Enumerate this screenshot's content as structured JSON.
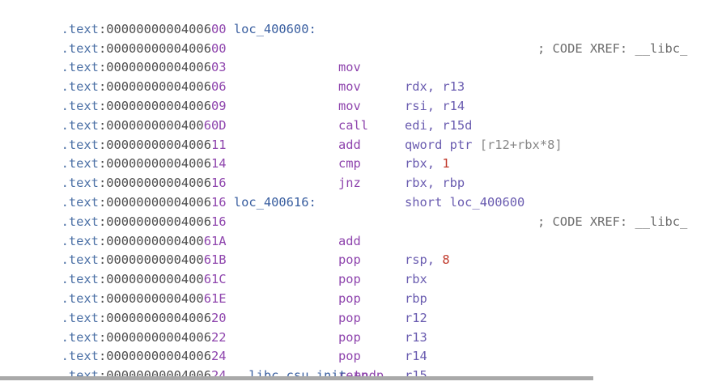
{
  "disassembly": {
    "rows": [
      {
        "seg": ".text",
        "addr_prefix": "00000000004006",
        "addr_hex": "00",
        "label": "loc_400600:",
        "mnemonic": "",
        "op1": "",
        "op2": "",
        "comment": "; CODE XREF: __libc_"
      },
      {
        "seg": ".text",
        "addr_prefix": "00000000004006",
        "addr_hex": "00",
        "label": "",
        "mnemonic": "mov",
        "op1": "rdx,",
        "op2": "r13",
        "comment": ""
      },
      {
        "seg": ".text",
        "addr_prefix": "00000000004006",
        "addr_hex": "03",
        "label": "",
        "mnemonic": "mov",
        "op1": "rsi,",
        "op2": "r14",
        "comment": ""
      },
      {
        "seg": ".text",
        "addr_prefix": "00000000004006",
        "addr_hex": "06",
        "label": "",
        "mnemonic": "mov",
        "op1": "edi,",
        "op2": "r15d",
        "comment": ""
      },
      {
        "seg": ".text",
        "addr_prefix": "00000000004006",
        "addr_hex": "09",
        "label": "",
        "mnemonic": "call",
        "op1": "qword ptr",
        "op2": "[r12+rbx*8]",
        "comment": ""
      },
      {
        "seg": ".text",
        "addr_prefix": "0000000000400",
        "addr_hex": "60D",
        "label": "",
        "mnemonic": "add",
        "op1": "rbx,",
        "op2": "1",
        "comment": ""
      },
      {
        "seg": ".text",
        "addr_prefix": "00000000004006",
        "addr_hex": "11",
        "label": "",
        "mnemonic": "cmp",
        "op1": "rbx,",
        "op2": "rbp",
        "comment": ""
      },
      {
        "seg": ".text",
        "addr_prefix": "00000000004006",
        "addr_hex": "14",
        "label": "",
        "mnemonic": "jnz",
        "op1": "short",
        "op2": "loc_400600",
        "comment": ""
      },
      {
        "seg": ".text",
        "addr_prefix": "00000000004006",
        "addr_hex": "16",
        "label": "",
        "mnemonic": "",
        "op1": "",
        "op2": "",
        "comment": ""
      },
      {
        "seg": ".text",
        "addr_prefix": "00000000004006",
        "addr_hex": "16",
        "label": "loc_400616:",
        "mnemonic": "",
        "op1": "",
        "op2": "",
        "comment": "; CODE XREF: __libc_"
      },
      {
        "seg": ".text",
        "addr_prefix": "00000000004006",
        "addr_hex": "16",
        "label": "",
        "mnemonic": "add",
        "op1": "rsp,",
        "op2": "8",
        "comment": ""
      },
      {
        "seg": ".text",
        "addr_prefix": "0000000000400",
        "addr_hex": "61A",
        "label": "",
        "mnemonic": "pop",
        "op1": "rbx",
        "op2": "",
        "comment": ""
      },
      {
        "seg": ".text",
        "addr_prefix": "0000000000400",
        "addr_hex": "61B",
        "label": "",
        "mnemonic": "pop",
        "op1": "rbp",
        "op2": "",
        "comment": ""
      },
      {
        "seg": ".text",
        "addr_prefix": "0000000000400",
        "addr_hex": "61C",
        "label": "",
        "mnemonic": "pop",
        "op1": "r12",
        "op2": "",
        "comment": ""
      },
      {
        "seg": ".text",
        "addr_prefix": "0000000000400",
        "addr_hex": "61E",
        "label": "",
        "mnemonic": "pop",
        "op1": "r13",
        "op2": "",
        "comment": ""
      },
      {
        "seg": ".text",
        "addr_prefix": "00000000004006",
        "addr_hex": "20",
        "label": "",
        "mnemonic": "pop",
        "op1": "r14",
        "op2": "",
        "comment": ""
      },
      {
        "seg": ".text",
        "addr_prefix": "00000000004006",
        "addr_hex": "22",
        "label": "",
        "mnemonic": "pop",
        "op1": "r15",
        "op2": "",
        "comment": ""
      },
      {
        "seg": ".text",
        "addr_prefix": "00000000004006",
        "addr_hex": "24",
        "label": "",
        "mnemonic": "retn",
        "op1": "",
        "op2": "",
        "comment": ""
      },
      {
        "seg": ".text",
        "addr_prefix": "00000000004006",
        "addr_hex": "24",
        "label": "__libc_csu_init",
        "mnemonic": "endp",
        "op1": "",
        "op2": "",
        "comment": ""
      }
    ]
  },
  "colors": {
    "segment": "#4a6fa5",
    "mnemonic": "#8e44ad",
    "operand": "#6a5cb0",
    "immediate": "#c0392b",
    "comment": "#6d6d6d",
    "scroll_thumb": "#a9a9a9"
  }
}
